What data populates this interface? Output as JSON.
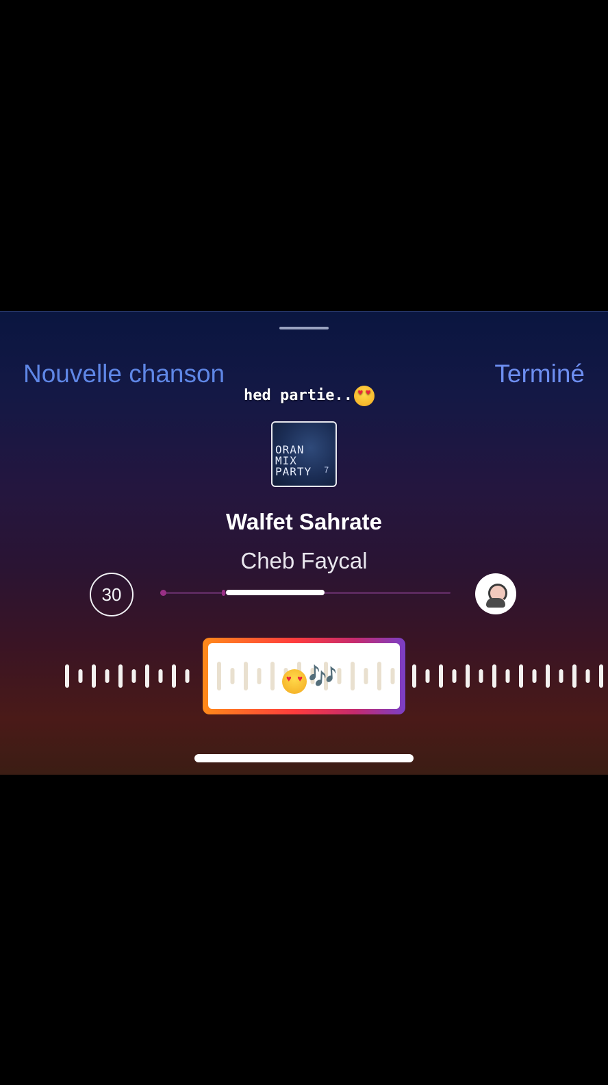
{
  "header": {
    "left_button": "Nouvelle chanson",
    "right_button": "Terminé"
  },
  "caption": {
    "text": "hed partie..",
    "emoji": "heart-eyes-emoji"
  },
  "album": {
    "cover_text": "ORAN\nMIX\nPARTY",
    "cover_number": "7"
  },
  "song": {
    "title": "Walfet Sahrate",
    "artist": "Cheb Faycal"
  },
  "controls": {
    "duration": "30",
    "timeline_position": 0.3,
    "timeline_visible_fraction": 0.34
  },
  "selection": {
    "label_icons": [
      "heart-eyes-emoji",
      "music-notes-icon"
    ],
    "notes": "🎶"
  },
  "colors": {
    "accent_blue": "#6d8ef0",
    "selector_gradient_start": "#ff8a1a",
    "selector_gradient_end": "#7a3fc6"
  }
}
